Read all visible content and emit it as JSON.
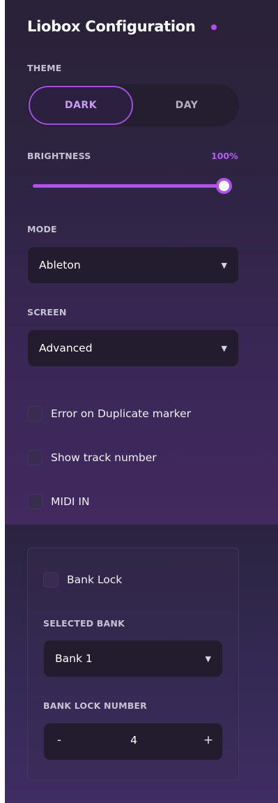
{
  "title": "Liobox Configuration",
  "theme": {
    "label": "THEME",
    "options": [
      "DARK",
      "DAY"
    ],
    "selected": "DARK"
  },
  "brightness": {
    "label": "BRIGHTNESS",
    "value_text": "100%",
    "value": 1.0
  },
  "mode": {
    "label": "MODE",
    "value": "Ableton"
  },
  "screen": {
    "label": "SCREEN",
    "value": "Advanced"
  },
  "options": [
    {
      "label": "Error on Duplicate marker",
      "checked": false
    },
    {
      "label": "Show track number",
      "checked": false
    },
    {
      "label": "MIDI IN",
      "checked": false
    }
  ],
  "bank": {
    "lock_label": "Bank Lock",
    "lock_checked": false,
    "selected_label": "SELECTED BANK",
    "selected_value": "Bank 1",
    "number_label": "BANK LOCK NUMBER",
    "number_value": "4",
    "minus": "-",
    "plus": "+"
  },
  "icons": {
    "dropdown": "chevron-down-icon",
    "status": "status-dot-icon"
  },
  "colors": {
    "accent": "#b052ec",
    "accent_text": "#b15ef0",
    "panel_bg": "#2e2443",
    "field_bg": "#231c2f"
  }
}
